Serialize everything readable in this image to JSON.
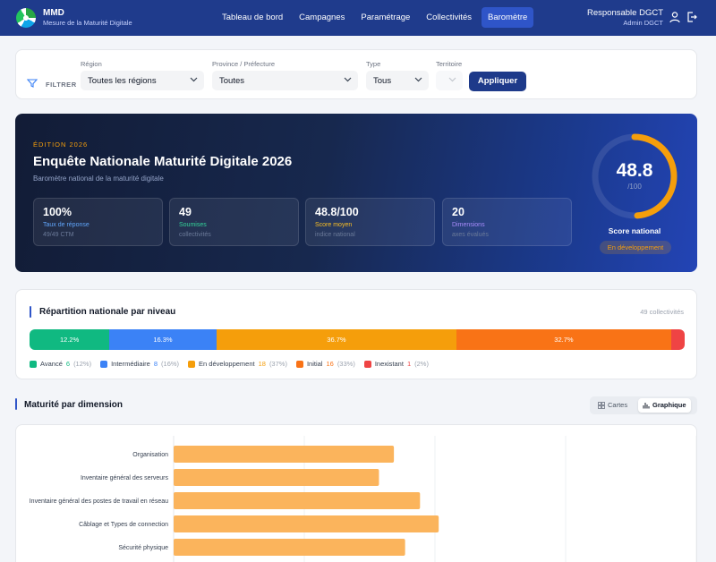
{
  "header": {
    "brand_title": "MMD",
    "brand_subtitle": "Mesure de la Maturité Digitale",
    "nav": [
      "Tableau de bord",
      "Campagnes",
      "Paramétrage",
      "Collectivités",
      "Baromètre"
    ],
    "active_nav": "Baromètre",
    "user_name": "Responsable DGCT",
    "user_role": "Admin DGCT"
  },
  "filters": {
    "label": "FILTRER",
    "region": {
      "label": "Région",
      "value": "Toutes les régions"
    },
    "province": {
      "label": "Province / Préfecture",
      "value": "Toutes"
    },
    "type": {
      "label": "Type",
      "value": "Tous"
    },
    "territoire": {
      "label": "Territoire",
      "value": ""
    },
    "apply_label": "Appliquer"
  },
  "hero": {
    "edition": "ÉDITION 2026",
    "title": "Enquête Nationale Maturité Digitale 2026",
    "subtitle": "Baromètre national de la maturité digitale",
    "stats": [
      {
        "value": "100%",
        "label": "Taux de réponse",
        "sub": "49/49 CTM",
        "color": "#60a5fa"
      },
      {
        "value": "49",
        "label": "Soumises",
        "sub": "collectivités",
        "color": "#34d399"
      },
      {
        "value": "48.8/100",
        "label": "Score moyen",
        "sub": "indice national",
        "color": "#fbbf24"
      },
      {
        "value": "20",
        "label": "Dimensions",
        "sub": "axes évalués",
        "color": "#a78bfa"
      }
    ],
    "score": "48.8",
    "score_max": "/100",
    "score_fraction": 0.488,
    "score_label": "Score national",
    "score_badge": "En développement"
  },
  "distribution": {
    "title": "Répartition nationale par niveau",
    "count_label": "49 collectivités",
    "segments": [
      {
        "name": "Avancé",
        "count": "6",
        "pct": "12.2%",
        "pct_short": "(12%)",
        "share": 12.2,
        "color": "#10b981"
      },
      {
        "name": "Intermédiaire",
        "count": "8",
        "pct": "16.3%",
        "pct_short": "(16%)",
        "share": 16.3,
        "color": "#3b82f6"
      },
      {
        "name": "En développement",
        "count": "18",
        "pct": "36.7%",
        "pct_short": "(37%)",
        "share": 36.7,
        "color": "#f59e0b"
      },
      {
        "name": "Initial",
        "count": "16",
        "pct": "32.7%",
        "pct_short": "(33%)",
        "share": 32.7,
        "color": "#f97316"
      },
      {
        "name": "Inexistant",
        "count": "1",
        "pct": "",
        "pct_short": "(2%)",
        "share": 2.1,
        "color": "#ef4444"
      }
    ]
  },
  "dimensions": {
    "title": "Maturité par dimension",
    "view_cards": "Cartes",
    "view_chart": "Graphique",
    "active_view": "Graphique"
  },
  "chart_data": {
    "type": "bar",
    "orientation": "horizontal",
    "categories": [
      "Organisation",
      "Inventaire général des serveurs",
      "Inventaire général des postes de travail en réseau",
      "Câblage et Types de connection",
      "Sécurité physique"
    ],
    "values": [
      59,
      55,
      66,
      71,
      62
    ],
    "xlim": [
      0,
      140
    ],
    "grid": true,
    "color": "#fbb45c"
  }
}
